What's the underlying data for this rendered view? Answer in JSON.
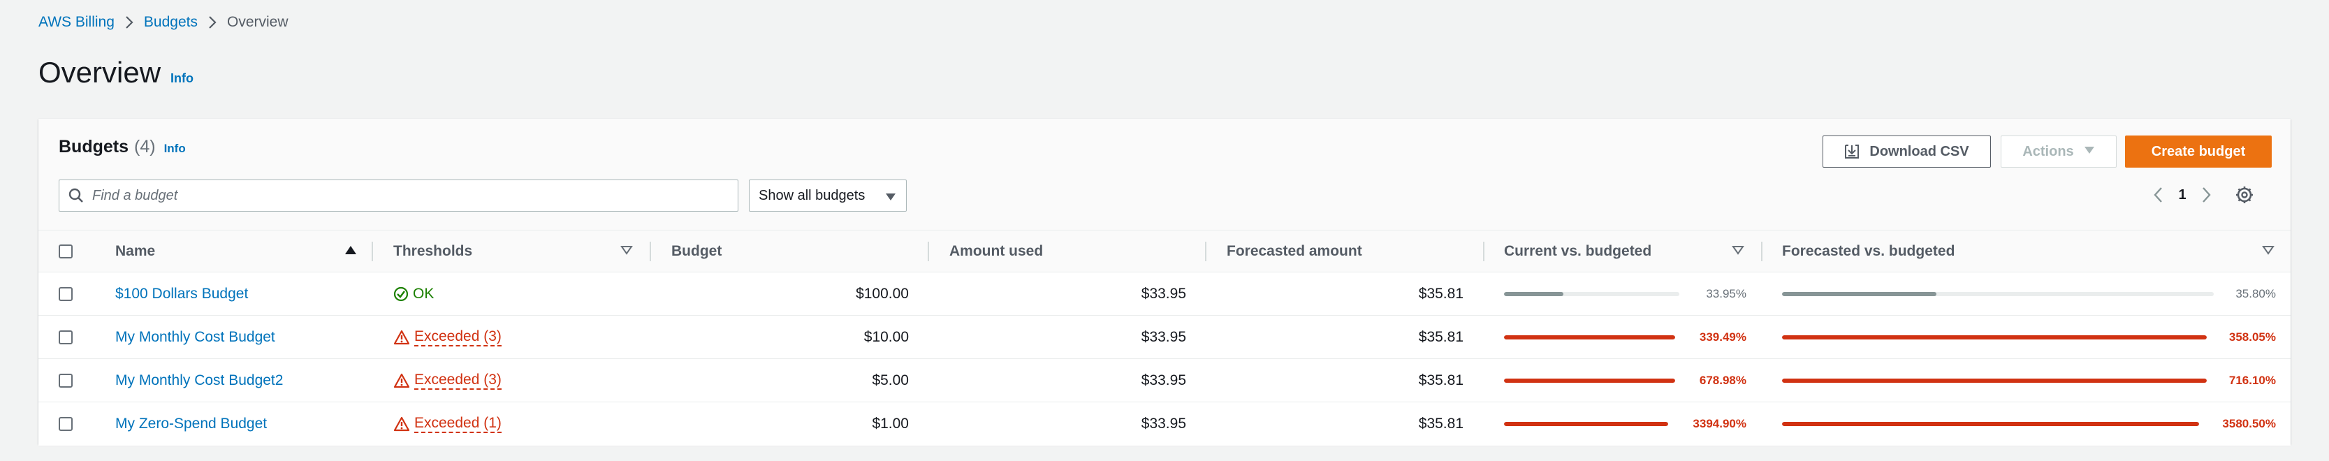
{
  "breadcrumb": [
    "AWS Billing",
    "Budgets",
    "Overview"
  ],
  "page": {
    "title": "Overview",
    "info": "Info"
  },
  "panel": {
    "title": "Budgets",
    "count": "(4)",
    "info": "Info",
    "download_label": "Download CSV",
    "actions_label": "Actions",
    "create_label": "Create budget",
    "search_placeholder": "Find a budget",
    "filter_value": "Show all budgets",
    "page_number": "1"
  },
  "columns": {
    "name": "Name",
    "thresholds": "Thresholds",
    "budget": "Budget",
    "amount_used": "Amount used",
    "forecasted": "Forecasted amount",
    "current_vs": "Current vs. budgeted",
    "forecast_vs": "Forecasted vs. budgeted"
  },
  "colors": {
    "link": "#0073bb",
    "ok": "#1d8102",
    "exceeded": "#d13212",
    "bar_ok": "#879596",
    "bar_exceeded": "#d13212",
    "primary": "#ec7211"
  },
  "rows": [
    {
      "name": "$100 Dollars Budget",
      "status": "ok",
      "threshold": "OK",
      "budget": "$100.00",
      "used": "$33.95",
      "forecast": "$35.81",
      "current_pct": "33.95%",
      "current_level": 0.3395,
      "forecast_pct": "35.80%",
      "forecast_level": 0.358
    },
    {
      "name": "My Monthly Cost Budget",
      "status": "exceeded",
      "threshold": "Exceeded (3)",
      "budget": "$10.00",
      "used": "$33.95",
      "forecast": "$35.81",
      "current_pct": "339.49%",
      "current_level": 1,
      "forecast_pct": "358.05%",
      "forecast_level": 1
    },
    {
      "name": "My Monthly Cost Budget2",
      "status": "exceeded",
      "threshold": "Exceeded (3)",
      "budget": "$5.00",
      "used": "$33.95",
      "forecast": "$35.81",
      "current_pct": "678.98%",
      "current_level": 1,
      "forecast_pct": "716.10%",
      "forecast_level": 1
    },
    {
      "name": "My Zero-Spend Budget",
      "status": "exceeded",
      "threshold": "Exceeded (1)",
      "budget": "$1.00",
      "used": "$33.95",
      "forecast": "$35.81",
      "current_pct": "3394.90%",
      "current_level": 1,
      "forecast_pct": "3580.50%",
      "forecast_level": 1
    }
  ]
}
